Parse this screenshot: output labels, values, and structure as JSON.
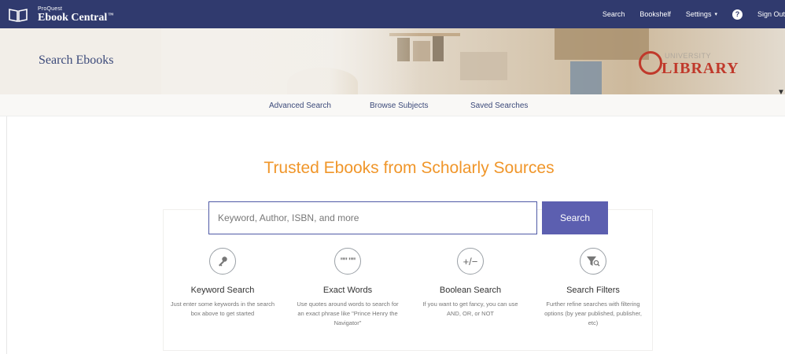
{
  "topbar": {
    "brand_sup": "ProQuest",
    "brand_name": "Ebook Central",
    "brand_tm": "™",
    "nav": {
      "search": "Search",
      "bookshelf": "Bookshelf",
      "settings": "Settings",
      "help": "?",
      "sign_out": "Sign Out"
    }
  },
  "banner": {
    "title": "Search Ebooks",
    "logo_sub": "UNIVERSITY",
    "logo_main": "LIBRARY"
  },
  "subnav": {
    "advanced": "Advanced Search",
    "browse": "Browse Subjects",
    "saved": "Saved Searches"
  },
  "main": {
    "headline": "Trusted Ebooks from Scholarly Sources",
    "search_placeholder": "Keyword, Author, ISBN, and more",
    "search_button": "Search",
    "features": [
      {
        "icon": "key-icon",
        "title": "Keyword Search",
        "desc": "Just enter some keywords in the search box above to get started"
      },
      {
        "icon": "quotes-icon",
        "title": "Exact Words",
        "desc": "Use quotes around words to search for an exact phrase like \"Prince Henry the Navigator\""
      },
      {
        "icon": "plus-minus-icon",
        "title": "Boolean Search",
        "desc": "If you want to get fancy, you can use AND, OR, or NOT"
      },
      {
        "icon": "filter-icon",
        "title": "Search Filters",
        "desc": "Further refine searches with filtering options (by year published, publisher, etc)"
      }
    ]
  },
  "colors": {
    "topbar": "#303a6e",
    "accent_orange": "#f0962a",
    "button": "#5c5fb0",
    "logo_red": "#c0392b"
  }
}
